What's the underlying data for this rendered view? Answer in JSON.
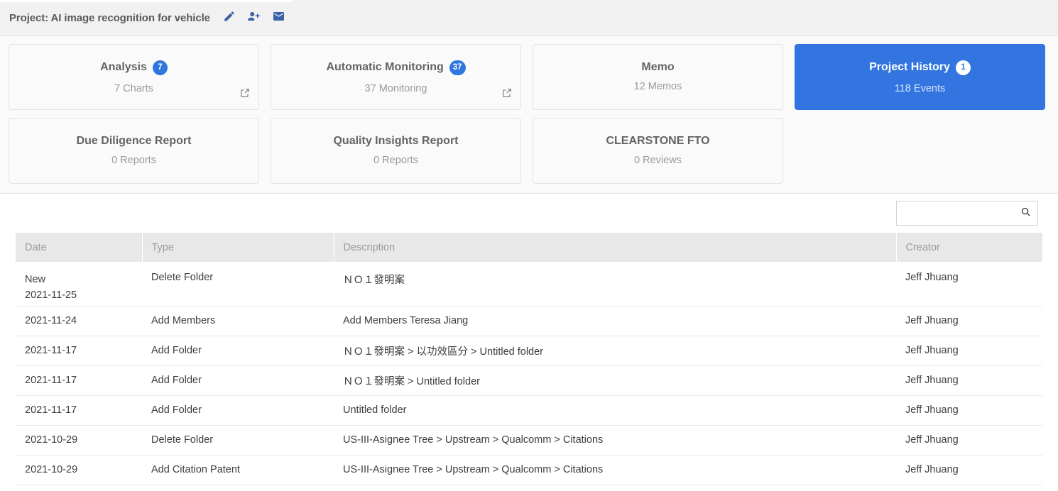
{
  "header": {
    "title": "Project: AI image recognition for vehicle",
    "icons": [
      {
        "name": "edit-pencil-icon"
      },
      {
        "name": "add-member-icon"
      },
      {
        "name": "mail-icon"
      }
    ]
  },
  "cards": [
    {
      "title": "Analysis",
      "badge": "7",
      "subtitle": "7 Charts",
      "active": false,
      "has_ext_link": true
    },
    {
      "title": "Automatic Monitoring",
      "badge": "37",
      "subtitle": "37 Monitoring",
      "active": false,
      "has_ext_link": true
    },
    {
      "title": "Memo",
      "badge": null,
      "subtitle": "12 Memos",
      "active": false,
      "has_ext_link": false
    },
    {
      "title": "Project History",
      "badge": "1",
      "subtitle": "118 Events",
      "active": true,
      "has_ext_link": false
    },
    {
      "title": "Due Diligence Report",
      "badge": null,
      "subtitle": "0 Reports",
      "active": false,
      "has_ext_link": false
    },
    {
      "title": "Quality Insights Report",
      "badge": null,
      "subtitle": "0 Reports",
      "active": false,
      "has_ext_link": false
    },
    {
      "title": "CLEARSTONE FTO",
      "badge": null,
      "subtitle": "0 Reviews",
      "active": false,
      "has_ext_link": false
    }
  ],
  "search": {
    "value": "",
    "placeholder": "",
    "icon": "search-icon"
  },
  "table": {
    "columns": [
      "Date",
      "Type",
      "Description",
      "Creator"
    ],
    "rows": [
      {
        "new_flag": "New",
        "date": "2021-11-25",
        "type": "Delete Folder",
        "description": "ＮＯ１發明案",
        "creator": "Jeff Jhuang"
      },
      {
        "new_flag": null,
        "date": "2021-11-24",
        "type": "Add Members",
        "description": "Add Members Teresa Jiang",
        "creator": "Jeff Jhuang"
      },
      {
        "new_flag": null,
        "date": "2021-11-17",
        "type": "Add Folder",
        "description": "ＮＯ１發明案 > 以功效區分 > Untitled folder",
        "creator": "Jeff Jhuang"
      },
      {
        "new_flag": null,
        "date": "2021-11-17",
        "type": "Add Folder",
        "description": "ＮＯ１發明案 > Untitled folder",
        "creator": "Jeff Jhuang"
      },
      {
        "new_flag": null,
        "date": "2021-11-17",
        "type": "Add Folder",
        "description": "Untitled folder",
        "creator": "Jeff Jhuang"
      },
      {
        "new_flag": null,
        "date": "2021-10-29",
        "type": "Delete Folder",
        "description": "US-III-Asignee Tree > Upstream > Qualcomm > Citations",
        "creator": "Jeff Jhuang"
      },
      {
        "new_flag": null,
        "date": "2021-10-29",
        "type": "Add Citation Patent",
        "description": "US-III-Asignee Tree > Upstream > Qualcomm > Citations",
        "creator": "Jeff Jhuang"
      }
    ]
  },
  "colors": {
    "accent_blue": "#3275e0",
    "badge_blue": "#2f76de",
    "header_bg": "#f1f1f1",
    "card_bg": "#fafafa",
    "table_header_bg": "#e8e8e8"
  }
}
